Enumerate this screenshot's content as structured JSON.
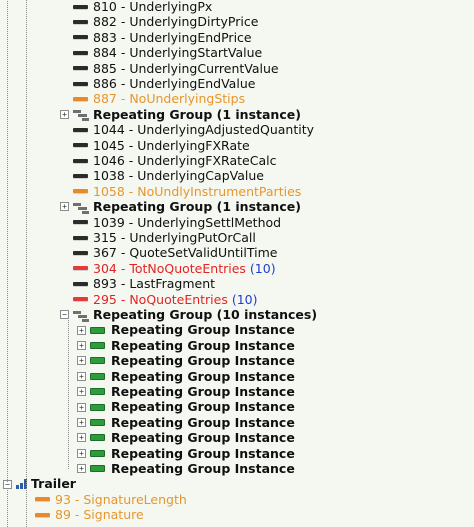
{
  "tree": {
    "fields_top": [
      {
        "label": "810 - UnderlyingPx",
        "style": "normal"
      },
      {
        "label": "882 - UnderlyingDirtyPrice",
        "style": "normal"
      },
      {
        "label": "883 - UnderlyingEndPrice",
        "style": "normal"
      },
      {
        "label": "884 - UnderlyingStartValue",
        "style": "normal"
      },
      {
        "label": "885 - UnderlyingCurrentValue",
        "style": "normal"
      },
      {
        "label": "886 - UnderlyingEndValue",
        "style": "normal"
      },
      {
        "label": "887 - NoUnderlyingStips",
        "style": "orange"
      }
    ],
    "group1": {
      "label": "Repeating Group (1 instance)"
    },
    "fields_mid": [
      {
        "label": "1044 - UnderlyingAdjustedQuantity",
        "style": "normal"
      },
      {
        "label": "1045 - UnderlyingFXRate",
        "style": "normal"
      },
      {
        "label": "1046 - UnderlyingFXRateCalc",
        "style": "normal"
      },
      {
        "label": "1038 - UnderlyingCapValue",
        "style": "normal"
      },
      {
        "label": "1058 - NoUndlyInstrumentParties",
        "style": "orange"
      }
    ],
    "group2": {
      "label": "Repeating Group (1 instance)"
    },
    "fields_low": [
      {
        "label": "1039 - UnderlyingSettlMethod",
        "style": "normal"
      },
      {
        "label": "315 - UnderlyingPutOrCall",
        "style": "normal"
      },
      {
        "label": "367 - QuoteSetValidUntilTime",
        "style": "normal"
      },
      {
        "label": "304 - TotNoQuoteEntries",
        "style": "red",
        "count": "(10)"
      },
      {
        "label": "893 - LastFragment",
        "style": "normal"
      },
      {
        "label": "295 - NoQuoteEntries",
        "style": "red",
        "count": "(10)"
      }
    ],
    "group3": {
      "label": "Repeating Group (10 instances)"
    },
    "instances": [
      "Repeating Group Instance",
      "Repeating Group Instance",
      "Repeating Group Instance",
      "Repeating Group Instance",
      "Repeating Group Instance",
      "Repeating Group Instance",
      "Repeating Group Instance",
      "Repeating Group Instance",
      "Repeating Group Instance",
      "Repeating Group Instance"
    ],
    "trailer": {
      "label": "Trailer",
      "fields": [
        {
          "label": "93 - SignatureLength",
          "style": "orange"
        },
        {
          "label": "89 - Signature",
          "style": "orange"
        }
      ]
    }
  },
  "icons": {
    "field": "field-bar-icon",
    "group": "repeating-group-icon",
    "instance": "group-instance-icon",
    "trailer": "trailer-icon"
  },
  "colors": {
    "normal_text": "#101010",
    "optional_text": "#e6962d",
    "required_text": "#e32424",
    "count_text": "#1d3fd0",
    "instance_icon": "#2e9b3c",
    "trailer_icon": "#2a5ea8"
  }
}
